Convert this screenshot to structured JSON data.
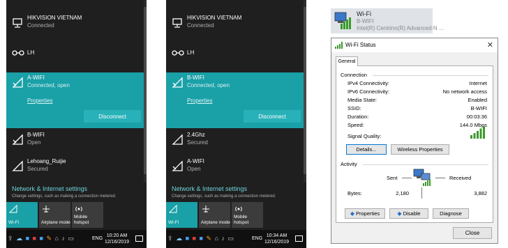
{
  "flyout1": {
    "networks": [
      {
        "name": "HIKVISION VIETNAM",
        "status": "Connected",
        "icon": "ethernet-icon"
      },
      {
        "name": "LH",
        "status": "",
        "icon": "dialup-icon"
      },
      {
        "name": "A-WIFI",
        "status": "Connected, open",
        "icon": "wifi-open-icon",
        "selected": true
      },
      {
        "name": "B-WIFI",
        "status": "Open",
        "icon": "wifi-open-icon"
      },
      {
        "name": "Lehoang_Ruijie",
        "status": "Secured",
        "icon": "wifi-secured-icon"
      }
    ],
    "properties_link": "Properties",
    "disconnect_label": "Disconnect",
    "settings_title": "Network & Internet settings",
    "settings_sub": "Change settings, such as making a connection metered.",
    "quick_actions": [
      {
        "label": "Wi-Fi",
        "icon": "wifi-icon",
        "on": true
      },
      {
        "label": "Airplane mode",
        "icon": "airplane-icon",
        "on": false
      },
      {
        "label": "Mobile hotspot",
        "icon": "hotspot-icon",
        "on": false
      }
    ],
    "taskbar": {
      "lang": "ENG",
      "time": "10:20 AM",
      "date": "12/16/2019"
    }
  },
  "flyout2": {
    "networks": [
      {
        "name": "HIKVISION VIETNAM",
        "status": "Connected",
        "icon": "ethernet-icon"
      },
      {
        "name": "LH",
        "status": "",
        "icon": "dialup-icon"
      },
      {
        "name": "B-WIFI",
        "status": "Connected, open",
        "icon": "wifi-open-icon",
        "selected": true
      },
      {
        "name": "2.4Ghz",
        "status": "Secured",
        "icon": "wifi-secured-icon"
      },
      {
        "name": "A-WIFI",
        "status": "Open",
        "icon": "wifi-open-icon"
      }
    ],
    "properties_link": "Properties",
    "disconnect_label": "Disconnect",
    "settings_title": "Network & Internet settings",
    "settings_sub": "Change settings, such as making a connection metered.",
    "quick_actions": [
      {
        "label": "Wi-Fi",
        "icon": "wifi-icon",
        "on": true
      },
      {
        "label": "Airplane mode",
        "icon": "airplane-icon",
        "on": false
      },
      {
        "label": "Mobile hotspot",
        "icon": "hotspot-icon",
        "on": false
      }
    ],
    "taskbar": {
      "lang": "ENG",
      "time": "10:34 AM",
      "date": "12/16/2019"
    }
  },
  "adapter": {
    "name": "Wi-Fi",
    "ssid": "B-WIFI",
    "device": "Intel(R) Centrino(R) Advanced-N ..."
  },
  "dialog": {
    "title": "Wi-Fi Status",
    "tab": "General",
    "connection_label": "Connection",
    "rows": [
      {
        "label": "IPv4 Connectivity:",
        "value": "Internet"
      },
      {
        "label": "IPv6 Connectivity:",
        "value": "No network access"
      },
      {
        "label": "Media State:",
        "value": "Enabled"
      },
      {
        "label": "SSID:",
        "value": "B-WIFI"
      },
      {
        "label": "Duration:",
        "value": "00:03:36"
      },
      {
        "label": "Speed:",
        "value": "144.0 Mbps"
      }
    ],
    "signal_label": "Signal Quality:",
    "signal_bars": 5,
    "details_button": "Details...",
    "wireless_props_button": "Wireless Properties",
    "activity_label": "Activity",
    "sent_label": "Sent",
    "received_label": "Received",
    "bytes_label": "Bytes:",
    "bytes_sent": "2,180",
    "bytes_received": "3,882",
    "properties_button": "Properties",
    "disable_button": "Disable",
    "diagnose_button": "Diagnose",
    "close_button": "Close"
  },
  "colors": {
    "accent": "#1aa0a7",
    "flyout_bg": "#1f1f1f",
    "signal_green": "#3a9a2a"
  }
}
